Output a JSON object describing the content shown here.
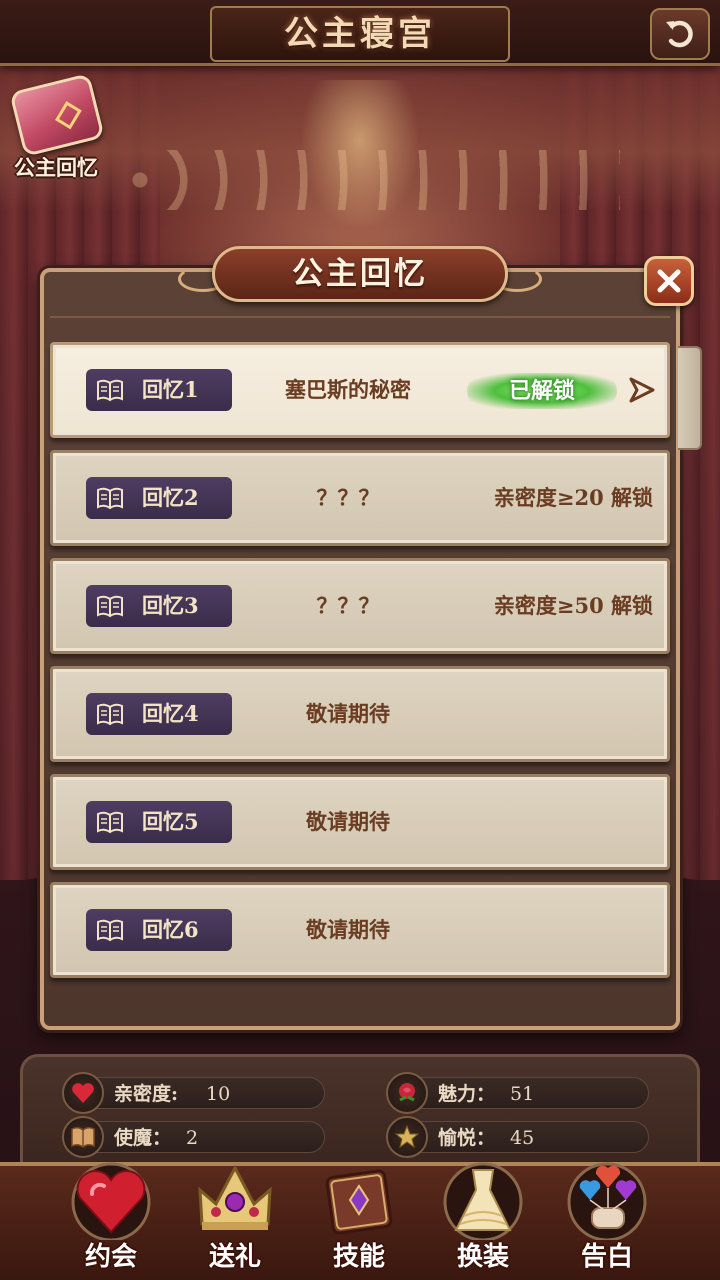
{
  "header": {
    "title": "公主寝宫"
  },
  "side_button": {
    "label": "公主回忆"
  },
  "modal": {
    "title": "公主回忆",
    "rows": [
      {
        "tag": "回忆1",
        "name": "塞巴斯的秘密",
        "status": "已解锁",
        "condition": ""
      },
      {
        "tag": "回忆2",
        "name": "？？？",
        "status": "",
        "condition": "亲密度≥20 解锁"
      },
      {
        "tag": "回忆3",
        "name": "？？？",
        "status": "",
        "condition": "亲密度≥50 解锁"
      },
      {
        "tag": "回忆4",
        "name": "敬请期待",
        "status": "",
        "condition": ""
      },
      {
        "tag": "回忆5",
        "name": "敬请期待",
        "status": "",
        "condition": ""
      },
      {
        "tag": "回忆6",
        "name": "敬请期待",
        "status": "",
        "condition": ""
      }
    ]
  },
  "stats": {
    "intimacy": {
      "label": "亲密度:",
      "value": "10",
      "icon": "heart-icon"
    },
    "charm": {
      "label": "魅力：",
      "value": "51",
      "icon": "rose-icon"
    },
    "mana": {
      "label": "使魔：",
      "value": "2",
      "icon": "book-icon"
    },
    "joy": {
      "label": "愉悦：",
      "value": "45",
      "icon": "star-icon"
    }
  },
  "nav": {
    "date": "约会",
    "gift": "送礼",
    "skill": "技能",
    "outfit": "换装",
    "confess": "告白"
  },
  "colors": {
    "accent_gold": "#c9a07a",
    "tag_purple": "#4f3d62",
    "unlocked_green": "#4fbf3e",
    "row_text_brown": "#6a3d22"
  }
}
